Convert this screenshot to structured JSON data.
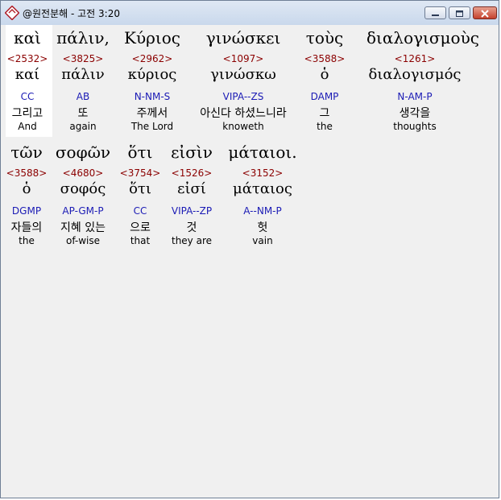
{
  "window": {
    "title": "@원전분해 - 고전 3:20",
    "icon": "app-icon",
    "buttons": {
      "minimize": "minimize-icon",
      "maximize": "maximize-icon",
      "close": "close-icon"
    }
  },
  "colors": {
    "strongs": "#8b0000",
    "morph": "#1b1bb5",
    "background": "#f0f0f0",
    "highlight": "#ffffff"
  },
  "words": [
    {
      "greek": "καὶ",
      "strongs": "<2532>",
      "lemma": "καί",
      "morph": "CC",
      "korean": "그리고",
      "english": "And"
    },
    {
      "greek": "πάλιν,",
      "strongs": "<3825>",
      "lemma": "πάλιν",
      "morph": "AB",
      "korean": "또",
      "english": "again"
    },
    {
      "greek": "Κύριος",
      "strongs": "<2962>",
      "lemma": "κύριος",
      "morph": "N-NM-S",
      "korean": "주께서",
      "english": "The Lord"
    },
    {
      "greek": "γινώσκει",
      "strongs": "<1097>",
      "lemma": "γινώσκω",
      "morph": "VIPA--ZS",
      "korean": "아신다 하셨느니라",
      "english": "knoweth"
    },
    {
      "greek": "τοὺς",
      "strongs": "<3588>",
      "lemma": "ὁ",
      "morph": "DAMP",
      "korean": "그",
      "english": "the"
    },
    {
      "greek": "διαλογισμοὺς",
      "strongs": "<1261>",
      "lemma": "διαλογισμός",
      "morph": "N-AM-P",
      "korean": "생각을",
      "english": "thoughts"
    },
    {
      "greek": "τῶν",
      "strongs": "<3588>",
      "lemma": "ὁ",
      "morph": "DGMP",
      "korean": "자들의",
      "english": "the"
    },
    {
      "greek": "σοφῶν",
      "strongs": "<4680>",
      "lemma": "σοφός",
      "morph": "AP-GM-P",
      "korean": "지혜 있는",
      "english": "of-wise"
    },
    {
      "greek": "ὅτι",
      "strongs": "<3754>",
      "lemma": "ὅτι",
      "morph": "CC",
      "korean": "으로",
      "english": "that"
    },
    {
      "greek": "εἰσὶν",
      "strongs": "<1526>",
      "lemma": "εἰσί",
      "morph": "VIPA--ZP",
      "korean": "것",
      "english": "they are"
    },
    {
      "greek": "μάταιοι.",
      "strongs": "<3152>",
      "lemma": "μάταιος",
      "morph": "A--NM-P",
      "korean": "헛",
      "english": "vain"
    }
  ]
}
